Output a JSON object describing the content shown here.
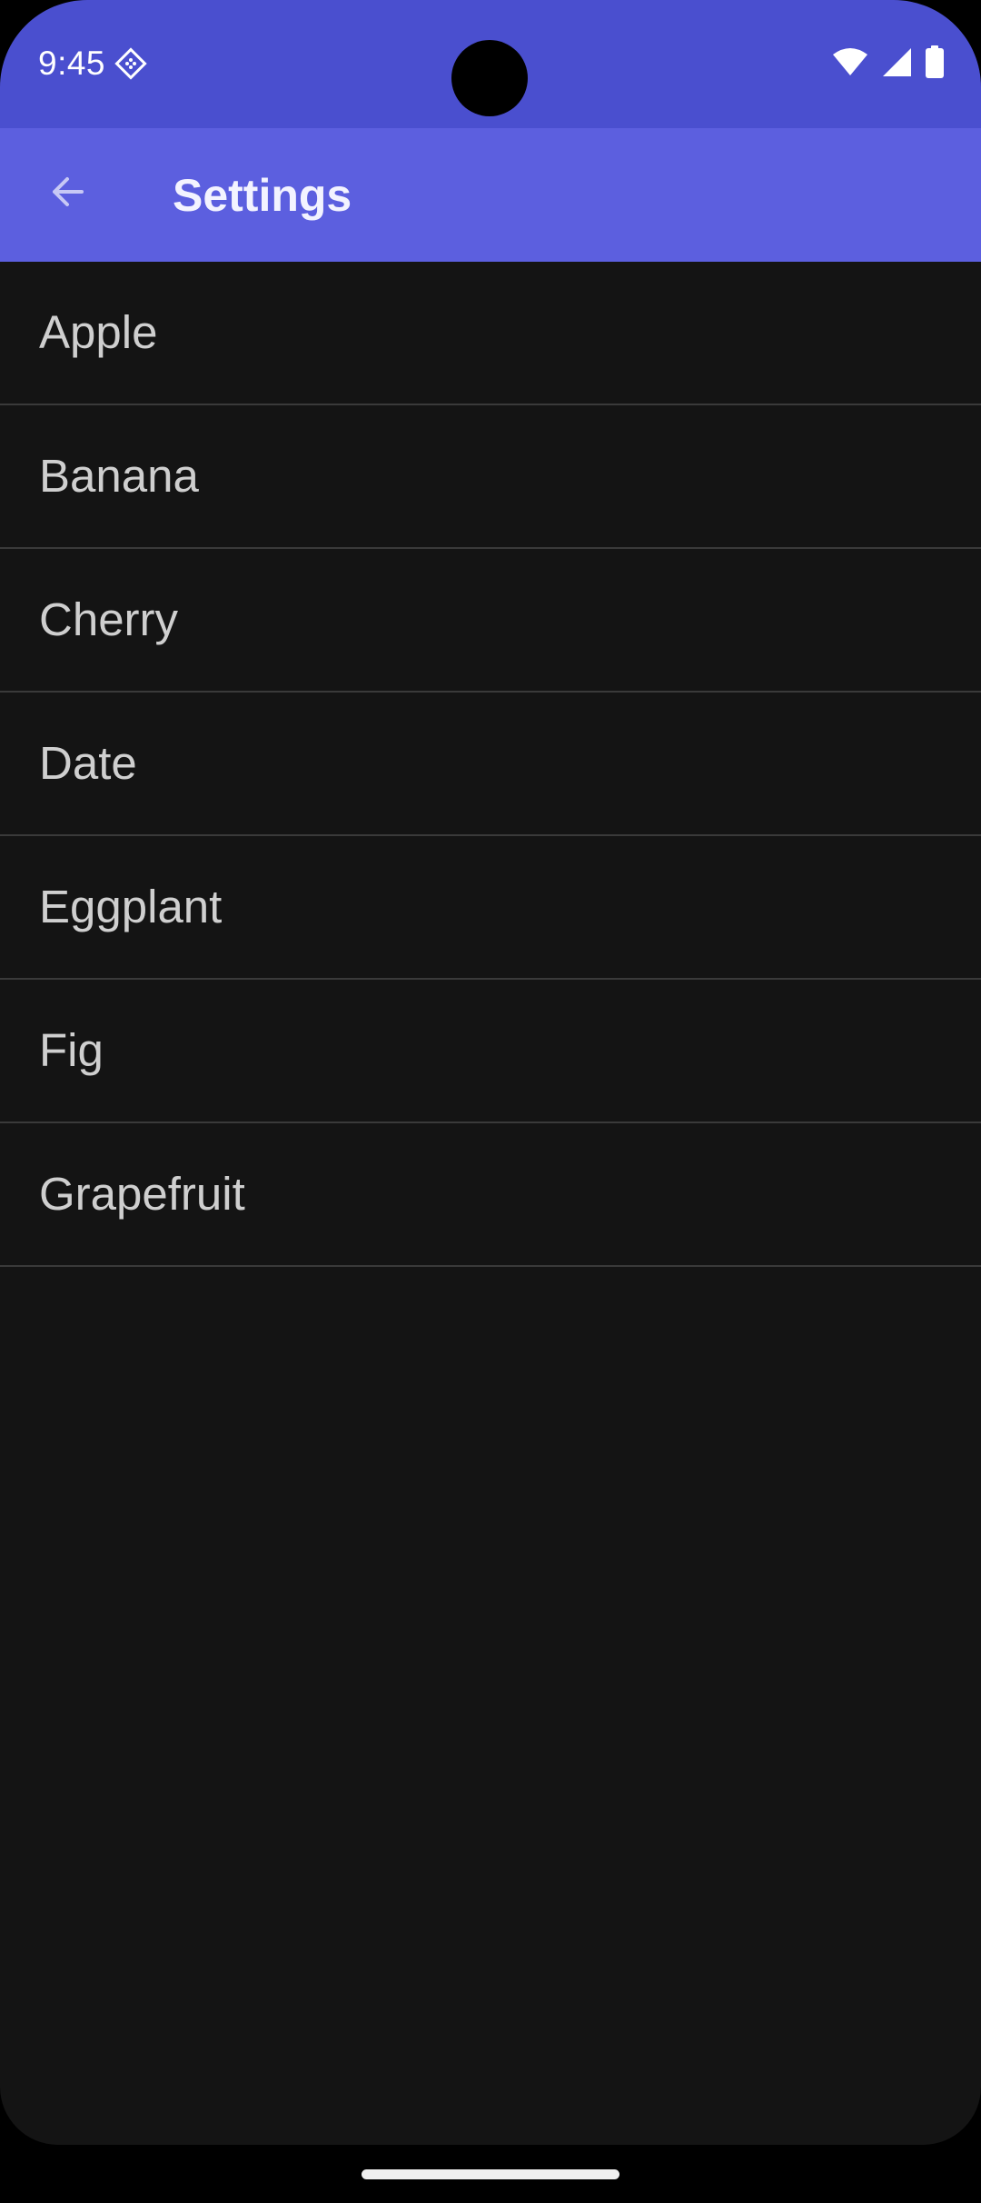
{
  "status_bar": {
    "time": "9:45",
    "icons": [
      "app-notification-icon",
      "wifi-icon",
      "cellular-signal-icon",
      "battery-icon"
    ],
    "background_color": "#4a4fcf"
  },
  "app_bar": {
    "title": "Settings",
    "back_icon": "arrow-back-icon",
    "background_color": "#5c5fdf"
  },
  "list": {
    "items": [
      {
        "label": "Apple"
      },
      {
        "label": "Banana"
      },
      {
        "label": "Cherry"
      },
      {
        "label": "Date"
      },
      {
        "label": "Eggplant"
      },
      {
        "label": "Fig"
      },
      {
        "label": "Grapefruit"
      }
    ]
  },
  "theme": {
    "background": "#141414",
    "divider": "#3a3a3a",
    "text": "#cfcfcf"
  }
}
